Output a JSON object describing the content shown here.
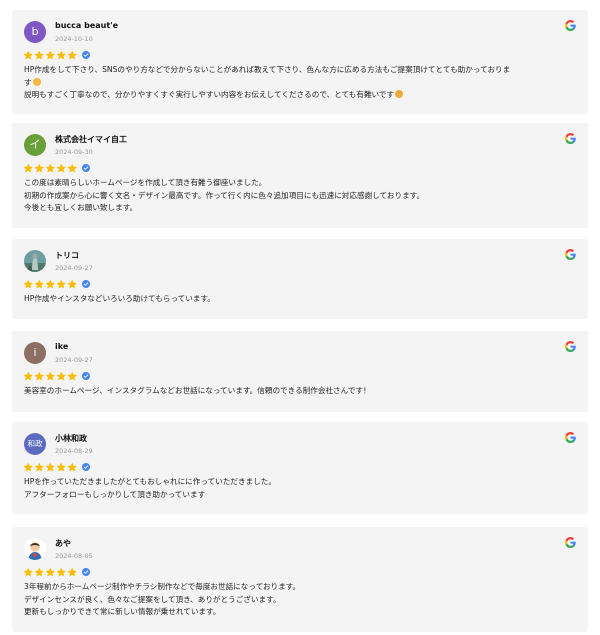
{
  "colors": {
    "card_bg": "#f4f4f4",
    "star": "#fbbc04",
    "verified": "#4285f4",
    "date": "#9a9a9a"
  },
  "icons": {
    "source": "google-icon",
    "rating": "star-icon",
    "badge": "verified-check-icon"
  },
  "reviews": [
    {
      "name": "bucca beaut'e",
      "date": "2024-10-10",
      "avatar": {
        "type": "letter",
        "text": "b",
        "color": "#7e57c2"
      },
      "rating": 5,
      "lines": [
        "HP作成をして下さり、SNSのやり方などで分からないことがあれば教えて下さり、色んな方に広める方法もご提案頂けてとても助かっておりま",
        "す",
        "説明もすごく丁寧なので、分かりやすくすぐ実行しやすい内容をお伝えしてくださるので、とても有難いです"
      ]
    },
    {
      "name": "株式会社イマイ自工",
      "date": "2024-09-30",
      "avatar": {
        "type": "letter",
        "text": "イ",
        "color": "#689f38"
      },
      "rating": 5,
      "lines": [
        "この度は素晴らしいホームページを作成して頂き有難う御座いました。",
        "初期の作成案から心に響く文名・デザイン最高です。作って行く内に色々追加項目にも迅速に対応感謝しております。",
        "今後とも宜しくお願い致します。"
      ]
    },
    {
      "name": "トリコ",
      "date": "2024-09-27",
      "avatar": {
        "type": "photo",
        "text": "",
        "color": "#7ba6a8"
      },
      "rating": 5,
      "lines": [
        "HP作成やインスタなどいろいろ助けてもらっています。"
      ]
    },
    {
      "name": "ike",
      "date": "2024-09-27",
      "avatar": {
        "type": "letter",
        "text": "i",
        "color": "#8d6e63"
      },
      "rating": 5,
      "lines": [
        "美容室のホームページ、インスタグラムなどお世話になっています。信頼のできる制作会社さんです！"
      ]
    },
    {
      "name": "小林和政",
      "date": "2024-08-29",
      "avatar": {
        "type": "letter",
        "text": "和政",
        "color": "#5c6bc0"
      },
      "rating": 5,
      "lines": [
        "HPを作っていただきましたがとてもおしゃれにに作っていただきました。",
        "アフターフォローもしっかりして頂き助かっています"
      ]
    },
    {
      "name": "あや",
      "date": "2024-08-05",
      "avatar": {
        "type": "photo",
        "text": "",
        "color": "#ffffff"
      },
      "rating": 5,
      "lines": [
        "3年程前からホームページ制作やチラシ制作などで毎度お世話になっております。",
        "デザインセンスが良く、色々なご提案をして頂き、ありがとうございます。",
        "更新もしっかりできて常に新しい情報が乗せれています。"
      ]
    }
  ]
}
